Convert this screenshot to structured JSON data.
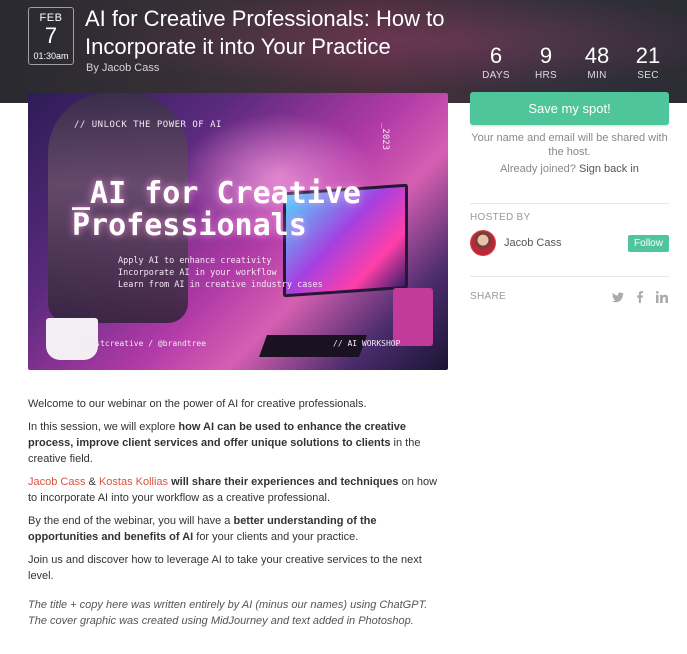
{
  "event": {
    "date_month": "FEB",
    "date_day": "7",
    "date_time": "01:30am",
    "title": "AI for Creative Professionals: How to Incorporate it into Your Practice",
    "byline": "By Jacob Cass"
  },
  "countdown": [
    {
      "value": "6",
      "unit": "DAYS"
    },
    {
      "value": "9",
      "unit": "HRS"
    },
    {
      "value": "48",
      "unit": "MIN"
    },
    {
      "value": "21",
      "unit": "SEC"
    }
  ],
  "cover": {
    "tag": "// UNLOCK THE POWER OF AI",
    "year": "_2023",
    "headline_1": "_AI for Creative",
    "headline_2": "Professionals",
    "line_1": "Apply AI to enhance creativity",
    "line_2": "Incorporate AI in your workflow",
    "line_3": "Learn from AI in creative industry cases",
    "foot_left": "_mjustcreative / @brandtree",
    "foot_right": "// AI WORKSHOP"
  },
  "sidebar": {
    "save_label": "Save my spot!",
    "share_note": "Your name and email will be shared with the host.",
    "already_joined": "Already joined?",
    "sign_back_in": "Sign back in",
    "hosted_by_label": "HOSTED BY",
    "host_name": "Jacob Cass",
    "follow_label": "Follow",
    "share_label": "SHARE",
    "share_icons": [
      "twitter-icon",
      "facebook-icon",
      "linkedin-icon"
    ]
  },
  "description": {
    "p1": "Welcome to our webinar on the power of AI for creative professionals.",
    "p2_a": "In this session, we will explore ",
    "p2_b": "how AI can be used to enhance the creative process, improve client services and offer unique solutions to clients",
    "p2_c": " in the creative field.",
    "p3_name1": "Jacob Cass",
    "p3_amp": " & ",
    "p3_name2": "Kostas Kollias",
    "p3_b": " will ",
    "p3_c": "share their experiences and techniques",
    "p3_d": " on how to incorporate AI into your workflow as a creative professional.",
    "p4_a": "By the end of the webinar, you will have a ",
    "p4_b": "better understanding of the opportunities and benefits of AI",
    "p4_c": " for your clients and your practice.",
    "p5": "Join us and discover how to leverage AI to take your creative services to the next level.",
    "note": "The title + copy here was written entirely by AI (minus our names) using ChatGPT. The cover graphic was created using MidJourney and text added in Photoshop."
  },
  "colors": {
    "accent": "#4fc59b",
    "link_red": "#d9533f"
  }
}
